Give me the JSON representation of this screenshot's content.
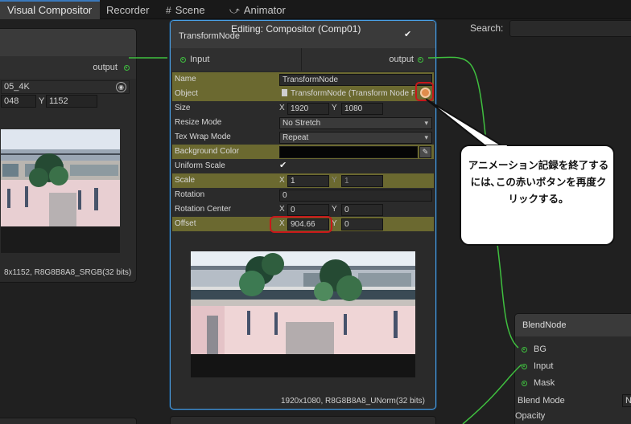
{
  "tabs": [
    {
      "label": "Visual Compositor",
      "icon": "",
      "active": true
    },
    {
      "label": "Recorder",
      "icon": "",
      "active": false
    },
    {
      "label": "Scene",
      "icon": "#",
      "active": false
    },
    {
      "label": "Animator",
      "icon": "⤻",
      "active": false
    }
  ],
  "search": {
    "label": "Search:",
    "value": ""
  },
  "left_node": {
    "output_label": "output",
    "asset_name": "05_4K",
    "width_value": "048",
    "y_label": "Y",
    "height_value": "1152",
    "caption": "8x1152, R8G8B8A8_SRGB(32 bits)"
  },
  "transform_node": {
    "title": "TransformNode",
    "editing_label": "Editing: Compositor (Comp01)",
    "input_label": "Input",
    "output_label": "output",
    "props": {
      "name": {
        "label": "Name",
        "value": "TransformNode"
      },
      "object": {
        "label": "Object",
        "value": "TransformNode (Transform Node P"
      },
      "size": {
        "label": "Size",
        "x_label": "X",
        "x": "1920",
        "y_label": "Y",
        "y": "1080"
      },
      "resize_mode": {
        "label": "Resize Mode",
        "value": "No Stretch"
      },
      "tex_wrap_mode": {
        "label": "Tex Wrap Mode",
        "value": "Repeat"
      },
      "background_color": {
        "label": "Background Color"
      },
      "uniform_scale": {
        "label": "Uniform Scale",
        "checked": true
      },
      "scale": {
        "label": "Scale",
        "x_label": "X",
        "x": "1",
        "y_label": "Y",
        "y": "1"
      },
      "rotation": {
        "label": "Rotation",
        "value": "0"
      },
      "rotation_center": {
        "label": "Rotation Center",
        "x_label": "X",
        "x": "0",
        "y_label": "Y",
        "y": "0"
      },
      "offset": {
        "label": "Offset",
        "x_label": "X",
        "x": "904.66",
        "y_label": "Y",
        "y": "0"
      }
    },
    "caption": "1920x1080, R8G8B8A8_UNorm(32 bits)"
  },
  "blend_node": {
    "title": "BlendNode",
    "ports": [
      "BG",
      "Input",
      "Mask"
    ],
    "blend_mode_label": "Blend Mode",
    "blend_mode_value": "N",
    "opacity_label": "Opacity"
  },
  "callout": {
    "text": "アニメーション記録を終了するには､この赤いボタンを再度クリックする。"
  },
  "colors": {
    "highlight_row": "#6b6930",
    "selected_border": "#4aa0e6",
    "port_green": "#3fbf3f",
    "annotation_red": "#c8181a",
    "record_button": "#e08c4c"
  }
}
